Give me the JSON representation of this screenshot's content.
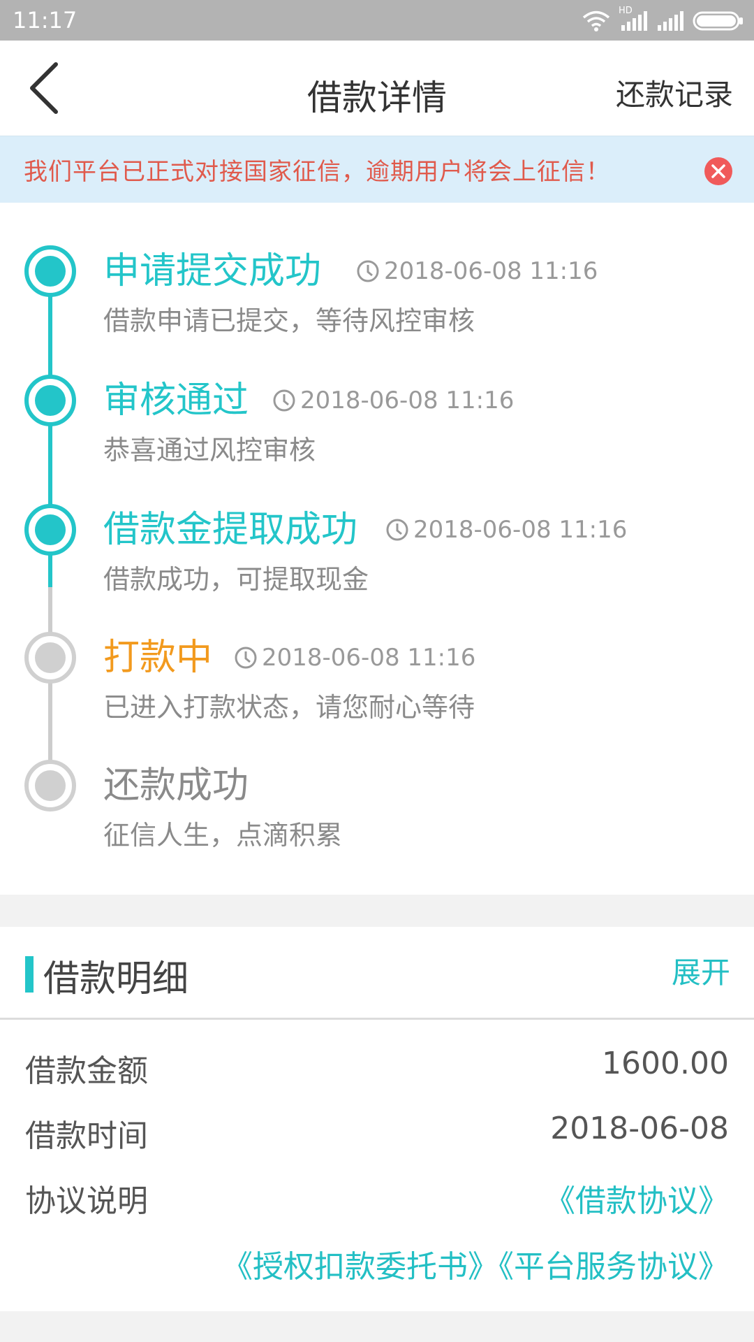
{
  "status_bar": {
    "time": "11:17",
    "network_badge": "HD"
  },
  "header": {
    "title": "借款详情",
    "right_link": "还款记录"
  },
  "notice": {
    "text": "我们平台已正式对接国家征信，逾期用户将会上征信！"
  },
  "colors": {
    "accent": "#23c5c9",
    "pending": "#f29a1e",
    "inactive": "#cccccc",
    "notice_text": "#e05a4c",
    "notice_bg": "#dbeefa"
  },
  "timeline": [
    {
      "title": "申请提交成功",
      "time": "2018-06-08 11:16",
      "desc": "借款申请已提交，等待风控审核",
      "state": "done"
    },
    {
      "title": "审核通过",
      "time": "2018-06-08 11:16",
      "desc": "恭喜通过风控审核",
      "state": "done"
    },
    {
      "title": "借款金提取成功",
      "time": "2018-06-08 11:16",
      "desc": "借款成功，可提取现金",
      "state": "done"
    },
    {
      "title": "打款中",
      "time": "2018-06-08 11:16",
      "desc": "已进入打款状态，请您耐心等待",
      "state": "current"
    },
    {
      "title": "还款成功",
      "time": "",
      "desc": "征信人生，点滴积累",
      "state": "pending"
    }
  ],
  "details": {
    "title": "借款明细",
    "expand_label": "展开",
    "rows": [
      {
        "label": "借款金额",
        "value": "1600.00"
      },
      {
        "label": "借款时间",
        "value": "2018-06-08"
      },
      {
        "label": "协议说明",
        "value": "《借款协议》"
      }
    ],
    "extra_links": "《授权扣款委托书》《平台服务协议》"
  }
}
